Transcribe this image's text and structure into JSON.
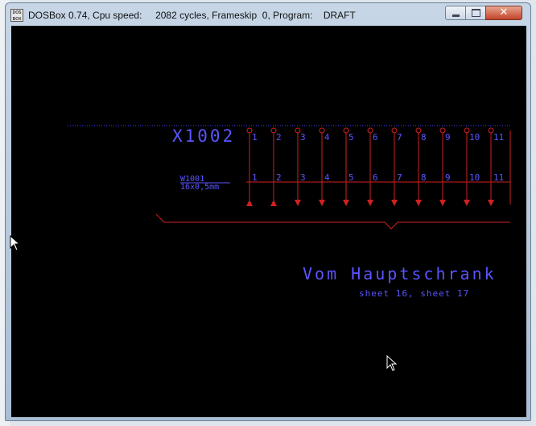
{
  "window": {
    "title": "DOSBox 0.74, Cpu speed:     2082 cycles, Frameskip  0, Program:    DRAFT",
    "icon_text": "DOS BOX",
    "close_glyph": "✕"
  },
  "drawing": {
    "connector_label": "X1002",
    "cable_label": "W1001",
    "cable_spec": "16x0,5mm",
    "pins_top": [
      "1",
      "2",
      "3",
      "4",
      "5",
      "6",
      "7",
      "8",
      "9",
      "10",
      "11"
    ],
    "pins_bottom": [
      "1",
      "2",
      "3",
      "4",
      "5",
      "6",
      "7",
      "8",
      "9",
      "10",
      "11"
    ],
    "destination_label": "Vom Hauptschrank",
    "sheet_ref": "sheet 16, sheet 17"
  },
  "colors": {
    "dos_background": "#000000",
    "text_blue": "#5a55ff",
    "wire_red": "#d02020",
    "dotted_line": "#4040ff"
  },
  "icons": {
    "mouse_cursor": "arrow-cursor-icon"
  }
}
